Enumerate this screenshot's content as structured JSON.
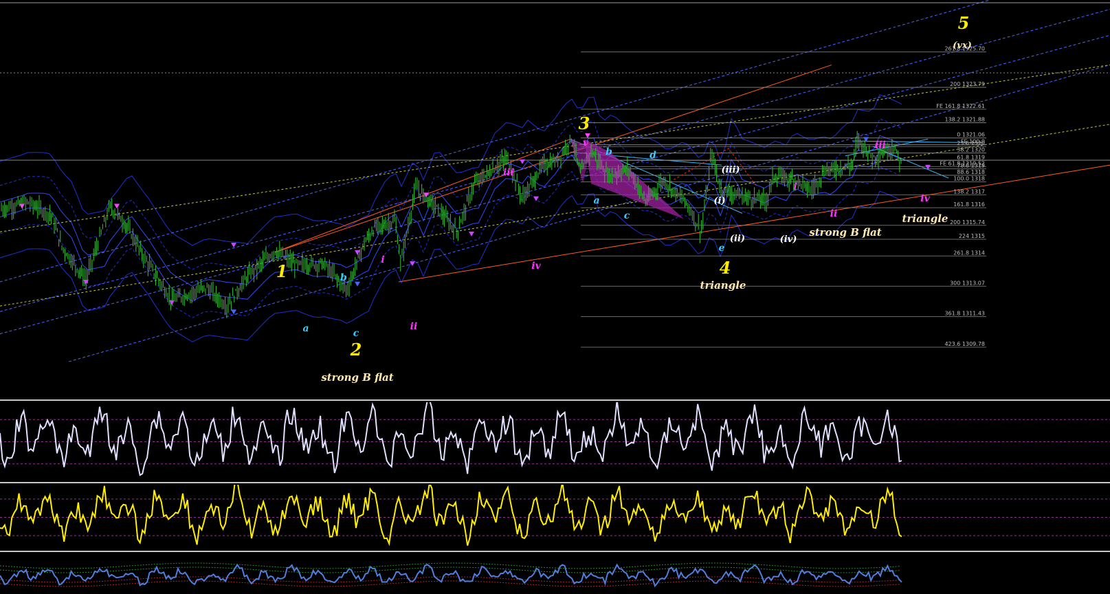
{
  "chart_data": [
    {
      "type": "line",
      "title": "",
      "y_range": [
        1307.0,
        1328.5
      ],
      "colors": {
        "background": "#000000",
        "candles": "#2fb72f",
        "wave_major": "#ffeb00",
        "wave_minor_magenta": "#ff33ff",
        "wave_cyan": "#33ccff",
        "wave_white": "#ffffff",
        "annotation_cream": "#ffe9b0",
        "channel_orange": "#ff5a1f",
        "fib_line": "#8c8c8c",
        "bands": "#2233dd"
      },
      "fib_levels": [
        {
          "label": "261.8 1325.70",
          "value": 1325.7
        },
        {
          "label": "200 1323.79",
          "value": 1323.79
        },
        {
          "label": "FE 161.8 1322.61",
          "value": 1322.61
        },
        {
          "label": "138.2 1321.88",
          "value": 1321.88
        },
        {
          "label": "0 1321.06",
          "value": 1321.06
        },
        {
          "label": "FE 100.0",
          "value": 1320.7
        },
        {
          "label": "23.6 1320",
          "value": 1320.6
        },
        {
          "label": "38.2 1320",
          "value": 1320.25
        },
        {
          "label": "61.8 1319",
          "value": 1319.85
        },
        {
          "label": "FE 61.8 1319.52",
          "value": 1319.52
        },
        {
          "label": "78.6 1319",
          "value": 1319.4
        },
        {
          "label": "88.6 1318",
          "value": 1319.05
        },
        {
          "label": "100.0 1318",
          "value": 1318.7
        },
        {
          "label": "138.2 1317",
          "value": 1318.0
        },
        {
          "label": "161.8 1316",
          "value": 1317.3
        },
        {
          "label": "200 1315.74",
          "value": 1316.35
        },
        {
          "label": "224 1315",
          "value": 1315.6
        },
        {
          "label": "261.8 1314",
          "value": 1314.7
        },
        {
          "label": "300 1313.07",
          "value": 1313.07
        },
        {
          "label": "361.8 1311.43",
          "value": 1311.43
        },
        {
          "label": "423.6 1309.78",
          "value": 1309.78
        }
      ],
      "price_path": [
        [
          0,
          1317.2
        ],
        [
          40,
          1317.6
        ],
        [
          75,
          1316.9
        ],
        [
          90,
          1315.2
        ],
        [
          125,
          1313.4
        ],
        [
          160,
          1317.4
        ],
        [
          185,
          1316.3
        ],
        [
          210,
          1314.6
        ],
        [
          250,
          1312.3
        ],
        [
          300,
          1313.0
        ],
        [
          330,
          1312.0
        ],
        [
          360,
          1313.6
        ],
        [
          400,
          1315.0
        ],
        [
          430,
          1314.2
        ],
        [
          470,
          1314.3
        ],
        [
          505,
          1312.9
        ],
        [
          530,
          1315.4
        ],
        [
          545,
          1316.2
        ],
        [
          575,
          1316.6
        ],
        [
          583,
          1314.3
        ],
        [
          605,
          1318.4
        ],
        [
          635,
          1317.3
        ],
        [
          665,
          1316.0
        ],
        [
          690,
          1318.6
        ],
        [
          715,
          1319.3
        ],
        [
          738,
          1320.0
        ],
        [
          760,
          1317.8
        ],
        [
          790,
          1319.6
        ],
        [
          810,
          1319.8
        ],
        [
          832,
          1321.1
        ],
        [
          845,
          1319.1
        ],
        [
          860,
          1320.4
        ],
        [
          885,
          1319.0
        ],
        [
          915,
          1319.4
        ],
        [
          940,
          1317.6
        ],
        [
          965,
          1318.8
        ],
        [
          1000,
          1317.5
        ],
        [
          1020,
          1316.0
        ],
        [
          1030,
          1318.5
        ],
        [
          1035,
          1320.3
        ],
        [
          1048,
          1318.3
        ],
        [
          1080,
          1317.9
        ],
        [
          1115,
          1317.7
        ],
        [
          1125,
          1319.0
        ],
        [
          1160,
          1318.8
        ],
        [
          1180,
          1318.2
        ],
        [
          1200,
          1319.3
        ],
        [
          1240,
          1319.6
        ],
        [
          1248,
          1321.0
        ],
        [
          1270,
          1320.0
        ],
        [
          1300,
          1320.6
        ],
        [
          1312,
          1319.6
        ]
      ],
      "wave_labels": {
        "major": [
          "1",
          "2",
          "3",
          "4",
          "5"
        ],
        "wave5_sub": "(vx)",
        "magenta": [
          "iii",
          "iv",
          "ii",
          "i",
          "v",
          "iii",
          "i",
          "ii",
          "iv"
        ],
        "cyan": [
          "a",
          "b",
          "c",
          "a",
          "b",
          "c",
          "d",
          "e"
        ],
        "white": [
          "(i)",
          "(ii)",
          "(iii)",
          "(iv)"
        ],
        "patterns": [
          "strong B flat",
          "triangle",
          "strong B flat",
          "triangle"
        ]
      }
    },
    {
      "type": "line",
      "color": "#e0e0ff",
      "count": 380
    },
    {
      "type": "line",
      "color": "#ffee00",
      "count": 380
    },
    {
      "type": "line",
      "color": "#4f7fe0",
      "count": 380
    }
  ]
}
